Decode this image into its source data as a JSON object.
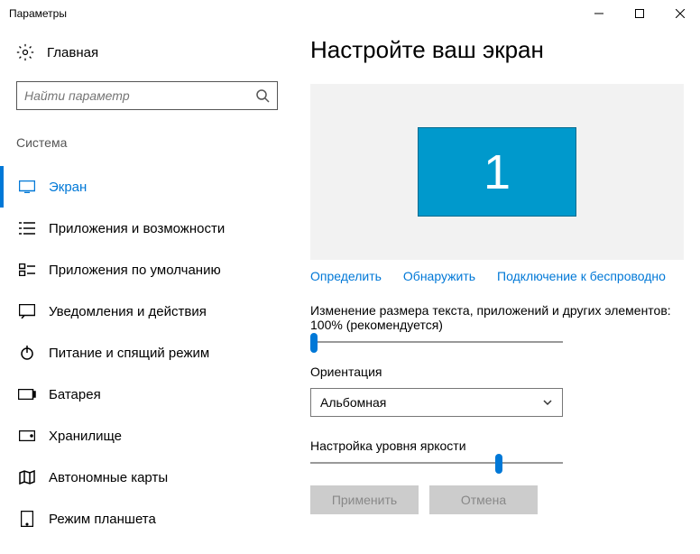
{
  "window": {
    "title": "Параметры"
  },
  "sidebar": {
    "home": "Главная",
    "search_placeholder": "Найти параметр",
    "section": "Система",
    "items": [
      {
        "label": "Экран"
      },
      {
        "label": "Приложения и возможности"
      },
      {
        "label": "Приложения по умолчанию"
      },
      {
        "label": "Уведомления и действия"
      },
      {
        "label": "Питание и спящий режим"
      },
      {
        "label": "Батарея"
      },
      {
        "label": "Хранилище"
      },
      {
        "label": "Автономные карты"
      },
      {
        "label": "Режим планшета"
      }
    ]
  },
  "main": {
    "heading": "Настройте ваш экран",
    "monitor_number": "1",
    "links": {
      "identify": "Определить",
      "detect": "Обнаружить",
      "wireless": "Подключение к беспроводно"
    },
    "scale_label": "Изменение размера текста, приложений и других элементов: 100% (рекомендуется)",
    "orientation_label": "Ориентация",
    "orientation_value": "Альбомная",
    "brightness_label": "Настройка уровня яркости",
    "apply": "Применить",
    "cancel": "Отмена"
  }
}
